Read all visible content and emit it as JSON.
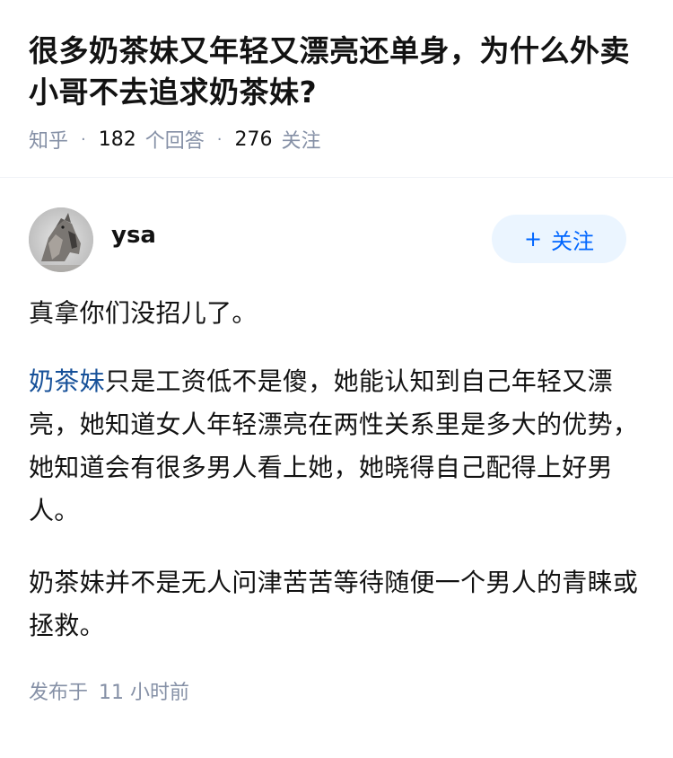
{
  "question": {
    "title": "很多奶茶妹又年轻又漂亮还单身，为什么外卖小哥不去追求奶茶妹?",
    "source": "知乎",
    "answers_count": "182",
    "answers_label": "个回答",
    "followers_count": "276",
    "followers_label": "关注"
  },
  "answer": {
    "author": {
      "name": "ysa",
      "follow_label": "关注"
    },
    "paragraphs": {
      "p1": "真拿你们没招儿了。",
      "p2_link": "奶茶妹",
      "p2_text": "只是工资低不是傻，她能认知到自己年轻又漂亮，她知道女人年轻漂亮在两性关系里是多大的优势，她知道会有很多男人看上她，她晓得自己配得上好男人。",
      "p3": "奶茶妹并不是无人问津苦苦等待随便一个男人的青睐或拯救。"
    },
    "publish_prefix": "发布于",
    "publish_time": "11 小时前"
  },
  "colors": {
    "accent": "#0066ff",
    "link": "#175199",
    "meta": "#8590a6",
    "follow_bg": "#ebf5ff"
  },
  "icons": {
    "avatar": "wolf-photo-avatar",
    "follow": "plus-icon"
  }
}
